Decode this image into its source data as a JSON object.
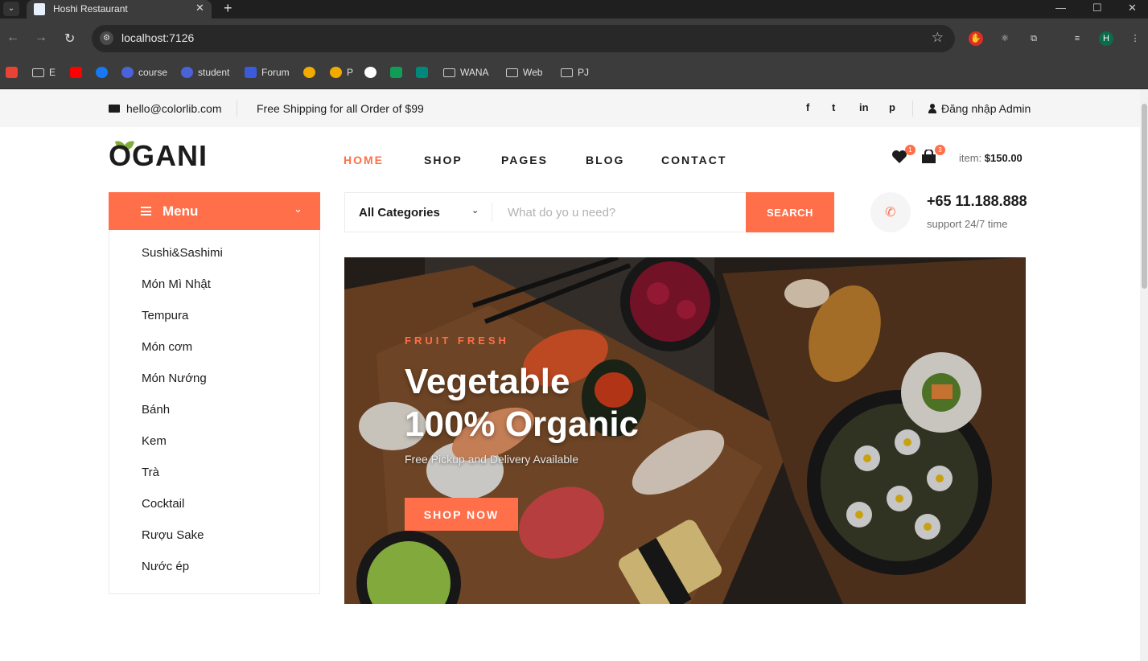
{
  "browser": {
    "tab_title": "Hoshi Restaurant",
    "url": "localhost:7126",
    "profile_initial": "H",
    "bookmarks": [
      "E",
      "course",
      "student",
      "Forum",
      "P",
      "WANA",
      "Web",
      "PJ"
    ]
  },
  "topbar": {
    "email": "hello@colorlib.com",
    "shipping": "Free Shipping for all Order of $99",
    "social": [
      "f",
      "t",
      "in",
      "p"
    ],
    "login": "Đăng nhập Admin"
  },
  "header": {
    "logo": "OGANI",
    "nav": [
      "HOME",
      "SHOP",
      "PAGES",
      "BLOG",
      "CONTACT"
    ],
    "wishlist_count": "1",
    "cart_count": "3",
    "item_label": "item:",
    "item_total": "$150.00"
  },
  "categories": {
    "title": "Menu",
    "items": [
      "Sushi&Sashimi",
      "Món Mì Nhật",
      "Tempura",
      "Món cơm",
      "Món Nướng",
      "Bánh",
      "Kem",
      "Trà",
      "Cocktail",
      "Rượu Sake",
      "Nước ép"
    ]
  },
  "search": {
    "category": "All Categories",
    "placeholder": "What do yo u need?",
    "button": "SEARCH"
  },
  "contact": {
    "phone": "+65 11.188.888",
    "support": "support 24/7 time"
  },
  "hero": {
    "kicker": "FRUIT FRESH",
    "title_line1": "Vegetable",
    "title_line2": "100% Organic",
    "subtitle": "Free Pickup and Delivery Available",
    "button": "SHOP NOW"
  },
  "colors": {
    "accent": "#ff6f49",
    "leaf": "#7fad39",
    "text": "#1c1c1c"
  }
}
